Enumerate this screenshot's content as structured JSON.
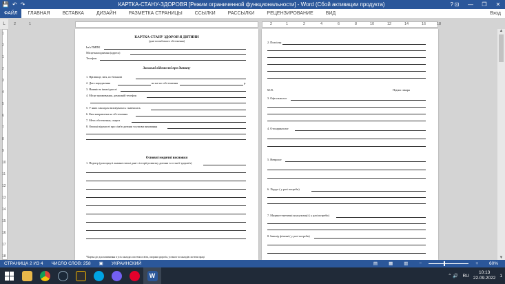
{
  "window": {
    "title": "КАРТКА-СТАНУ-ЗДОРОВЯ [Режим ограниченной функциональности] - Word (Сбой активации продукта)",
    "help": "?",
    "controls": {
      "ribbon_options": "⊡",
      "minimize": "—",
      "restore": "❐",
      "close": "✕"
    }
  },
  "qat": {
    "save": "💾",
    "undo": "↶",
    "redo": "↷"
  },
  "tabs": [
    {
      "label": "ФАЙЛ"
    },
    {
      "label": "ГЛАВНАЯ"
    },
    {
      "label": "ВСТАВКА"
    },
    {
      "label": "ДИЗАЙН"
    },
    {
      "label": "РАЗМЕТКА СТРАНИЦЫ"
    },
    {
      "label": "ССЫЛКИ"
    },
    {
      "label": "РАССЫЛКИ"
    },
    {
      "label": "РЕЦЕНЗИРОВАНИЕ"
    },
    {
      "label": "ВИД"
    }
  ],
  "account_label": "Вход",
  "ruler": {
    "h_numbers": [
      "2",
      "1",
      "2",
      "1",
      "2",
      "4",
      "6",
      "8",
      "10",
      "12",
      "14",
      "16",
      "18"
    ],
    "v_numbers": [
      "1",
      "2",
      "1",
      "2",
      "3",
      "4",
      "5",
      "6",
      "7",
      "8",
      "9",
      "10",
      "11",
      "12",
      "13",
      "14",
      "15",
      "16",
      "17",
      "18",
      "19"
    ]
  },
  "page1": {
    "title": "КАРТКА  СТАНУ  ЗДОРОВ'Я  ДИТИНИ",
    "subtitle": "(дані поглибленого обстеження)",
    "fields": [
      "Ім'я ПМПК",
      "Місцезнаходження (адреса)",
      "Телефон"
    ],
    "section1": "Загальні  відомості  про  дитину",
    "items": [
      "1.  Прізвище, ім'я, по батькові",
      "2.  Дата народження",
      "3.  Наявність інвалідності",
      "4.  Місце проживання, домашній телефон",
      "5.  У яких закладах виховувалась і навчалась",
      "6.  Ким направлена на обстеження",
      "7.  Мета обстеження, скарги",
      "8.  Описні відомості про сім'ю дитини та умови виховання"
    ],
    "age_label": "на на час обстеження",
    "suffix": "р.",
    "section2": "Основні медичні висновки",
    "item_pediatric": "1. Педіатр (розгорнуті анамнестичні дані з історії розвитку дитини та стан її здоров'я)",
    "footnote": "*Картка діє для заповнення в усіх закладах системи освіти, охорони здоров'я, установ та закладів системи праці"
  },
  "page2": {
    "items": [
      "2. Психіатр",
      "3. Офтальмолог",
      "4. Отоларинголог",
      "5. Невролог",
      "6. Хірург ( у разі потреби)",
      "7. Медико-генетичні консультації ( у разі потреби)",
      "8. Інвалід фізичні ( у разі потреби)"
    ],
    "stamp": "М.П.",
    "signature": "Підпис лікаря"
  },
  "status": {
    "page": "СТРАНИЦА 2 ИЗ 4",
    "words": "ЧИСЛО СЛОВ: 258",
    "language": "УКРАИНСКИЙ",
    "zoom": "60%",
    "zoom_minus": "−",
    "zoom_plus": "+"
  },
  "taskbar": {
    "language": "RU",
    "time": "10:13",
    "date": "22.09.2022",
    "notifications": "1",
    "tray_icons": "⌃  🔊"
  },
  "colors": {
    "word_blue": "#2b579a",
    "taskbar": "#202a38",
    "doc_bg": "#d4d4d4"
  }
}
